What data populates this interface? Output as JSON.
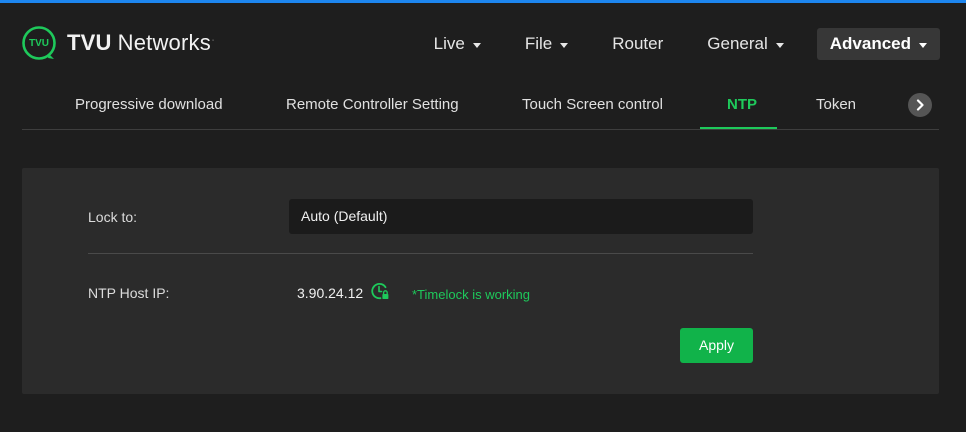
{
  "brand": {
    "logo_mark_text": "TVU",
    "name_bold": "TVU",
    "name_rest": "Networks",
    "trademark": "·"
  },
  "topnav": {
    "items": [
      {
        "label": "Live",
        "has_dropdown": true
      },
      {
        "label": "File",
        "has_dropdown": true
      },
      {
        "label": "Router",
        "has_dropdown": false
      },
      {
        "label": "General",
        "has_dropdown": true
      },
      {
        "label": "Advanced",
        "has_dropdown": true,
        "active": true
      }
    ]
  },
  "subtabs": {
    "items": [
      {
        "label": "Progressive download"
      },
      {
        "label": "Remote Controller Setting"
      },
      {
        "label": "Touch Screen control"
      },
      {
        "label": "NTP",
        "active": true
      },
      {
        "label": "Token"
      }
    ],
    "next_icon": "chevron-right-icon"
  },
  "ntp_panel": {
    "lock_to": {
      "label": "Lock to:",
      "selected_value": "Auto (Default)"
    },
    "host_ip": {
      "label": "NTP Host IP:",
      "value": "3.90.24.12",
      "icon": "clock-lock-icon",
      "status": "*Timelock is working"
    },
    "apply_label": "Apply"
  },
  "colors": {
    "background": "#1e1e1e",
    "panel": "#2b2b2b",
    "accent_green": "#1ec95b",
    "apply_button": "#11b34a",
    "top_border": "#1d86f0"
  }
}
